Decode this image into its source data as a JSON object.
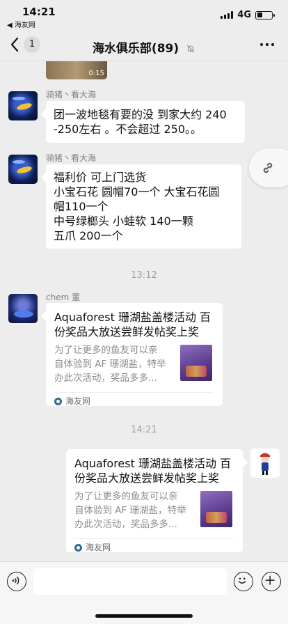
{
  "status_bar": {
    "time": "14:21",
    "back_app": "◀ 海友网",
    "network": "4G"
  },
  "nav": {
    "unread_count": "1",
    "title": "海水俱乐部(89)"
  },
  "video": {
    "duration": "0:15"
  },
  "messages": [
    {
      "sender": "骑猪丶看大海",
      "lines": [
        "团一波地毯有要的没 到家大约 240",
        "-250左右 。不会超过 250。。"
      ]
    },
    {
      "sender": "骑猪丶看大海",
      "lines": [
        "福利价 可上门选货",
        "小宝石花 圆帽70一个 大宝石花圆",
        "帽110一个",
        "中号绿榔头  小蛙软 140一颗",
        "五爪    200一个"
      ]
    }
  ],
  "time_separators": [
    "13:12",
    "14:21"
  ],
  "link_cards": [
    {
      "sender": "chem 董",
      "title_lines": [
        "Aquaforest 珊湖盐盖楼活动 百",
        "份奖品大放送尝鲜发帖奖上奖"
      ],
      "desc_lines": [
        "为了让更多的鱼友可以亲",
        "自体验到 AF 珊湖盐，特举",
        "办此次活动，奖品多多..."
      ],
      "source": "海友网"
    },
    {
      "title_lines": [
        "Aquaforest 珊湖盐盖楼活动 百",
        "份奖品大放送尝鲜发帖奖上奖"
      ],
      "desc_lines": [
        "为了让更多的鱼友可以亲",
        "自体验到 AF 珊湖盐，特举",
        "办此次活动，奖品多多..."
      ],
      "source": "海友网"
    }
  ],
  "icons": {
    "back": "chevron-left-icon",
    "mute": "bell-slash-icon",
    "more": "more-icon",
    "link": "link-icon",
    "voice": "voice-icon",
    "emoji": "emoji-icon",
    "plus": "plus-icon"
  }
}
